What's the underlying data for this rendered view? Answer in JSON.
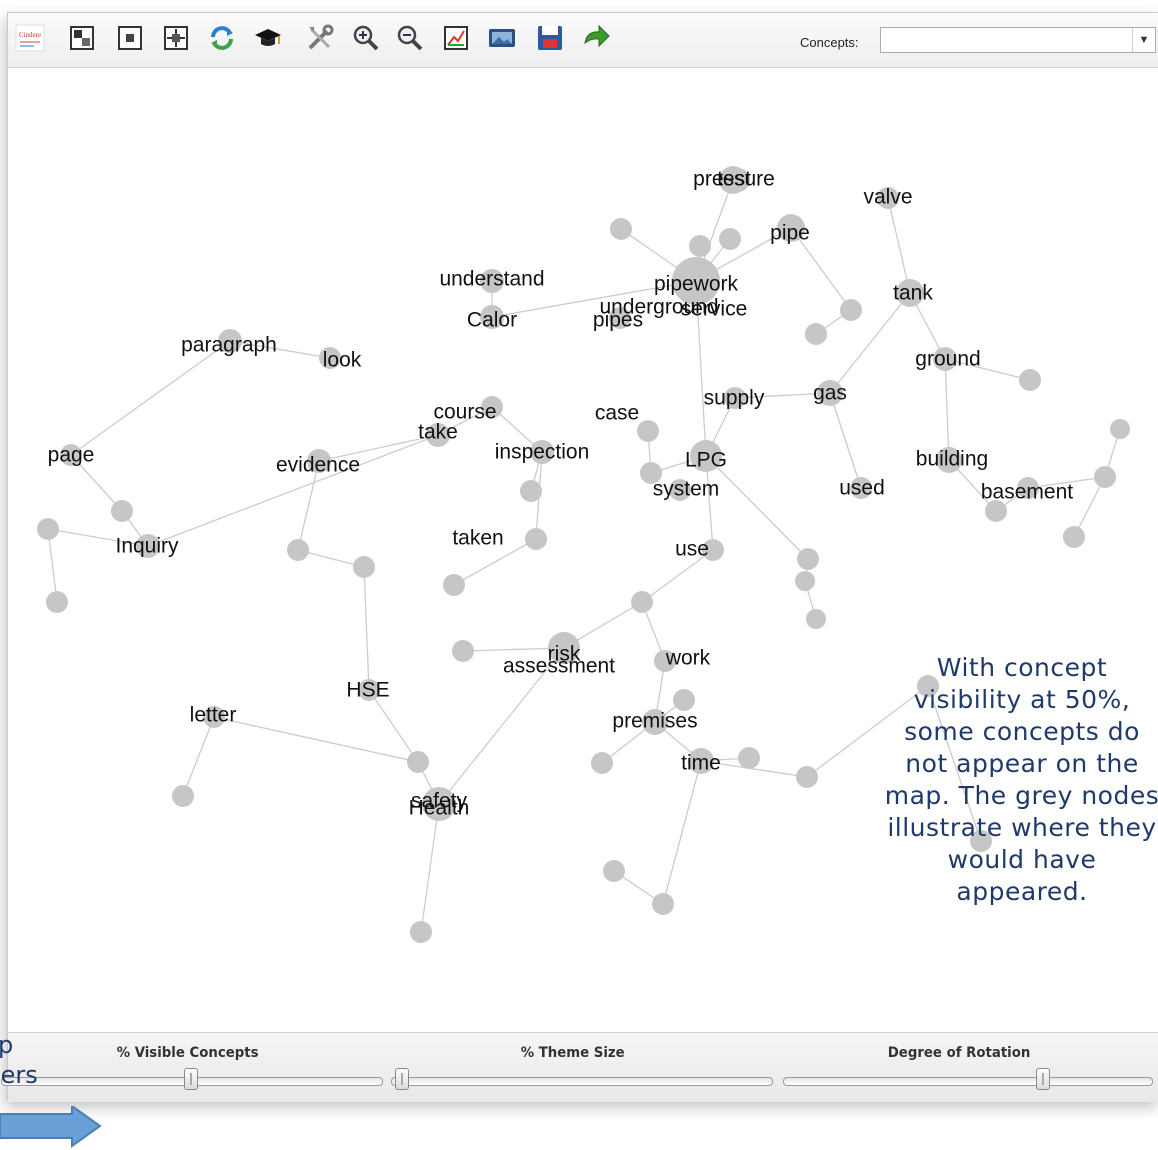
{
  "toolbar": {
    "icons": [
      "logo-icon",
      "layout-icon",
      "center-icon",
      "fit-icon",
      "refresh-icon",
      "grad-cap-icon",
      "tools-icon",
      "zoom-in-icon",
      "zoom-out-icon",
      "chart-icon",
      "image-icon",
      "save-icon",
      "forward-arrow-icon"
    ],
    "concepts_label": "Concepts:",
    "concepts_value": ""
  },
  "map": {
    "node_color": "#c6c6c6",
    "edge_color": "#cccccc",
    "labels": [
      {
        "id": "l1",
        "text": "pressure"
      },
      {
        "id": "l2",
        "text": "test"
      },
      {
        "id": "l3",
        "text": "valve"
      },
      {
        "id": "l4",
        "text": "pipe"
      },
      {
        "id": "l5",
        "text": "understand"
      },
      {
        "id": "l6",
        "text": "pipework"
      },
      {
        "id": "l7",
        "text": "tank"
      },
      {
        "id": "l8",
        "text": "underground"
      },
      {
        "id": "l9",
        "text": "service"
      },
      {
        "id": "l10",
        "text": "Calor"
      },
      {
        "id": "l11",
        "text": "pipes"
      },
      {
        "id": "l12",
        "text": "paragraph"
      },
      {
        "id": "l13",
        "text": "look"
      },
      {
        "id": "l14",
        "text": "ground"
      },
      {
        "id": "l15",
        "text": "gas"
      },
      {
        "id": "l16",
        "text": "supply"
      },
      {
        "id": "l17",
        "text": "course"
      },
      {
        "id": "l18",
        "text": "case"
      },
      {
        "id": "l19",
        "text": "take"
      },
      {
        "id": "l20",
        "text": "page"
      },
      {
        "id": "l21",
        "text": "inspection"
      },
      {
        "id": "l22",
        "text": "LPG"
      },
      {
        "id": "l23",
        "text": "building"
      },
      {
        "id": "l24",
        "text": "evidence"
      },
      {
        "id": "l25",
        "text": "system"
      },
      {
        "id": "l26",
        "text": "used"
      },
      {
        "id": "l27",
        "text": "basement"
      },
      {
        "id": "l28",
        "text": "taken"
      },
      {
        "id": "l29",
        "text": "Inquiry"
      },
      {
        "id": "l30",
        "text": "use"
      },
      {
        "id": "l31",
        "text": "risk"
      },
      {
        "id": "l32",
        "text": "assessment"
      },
      {
        "id": "l33",
        "text": "work"
      },
      {
        "id": "l34",
        "text": "HSE"
      },
      {
        "id": "l35",
        "text": "letter"
      },
      {
        "id": "l36",
        "text": "premises"
      },
      {
        "id": "l37",
        "text": "time"
      },
      {
        "id": "l38",
        "text": "safety"
      },
      {
        "id": "l39",
        "text": "Health"
      }
    ]
  },
  "annotation": "With concept visibility at 50%, some concepts do not appear on the map. The grey nodes illustrate where they would have appeared.",
  "sliders_note": {
    "line1": "p",
    "line2": "lers"
  },
  "sliders": [
    {
      "label": "% Visible Concepts",
      "value_fraction": 0.5
    },
    {
      "label": "% Theme Size",
      "value_fraction": 0.0
    },
    {
      "label": "Degree of Rotation",
      "value_fraction": 0.72
    }
  ]
}
